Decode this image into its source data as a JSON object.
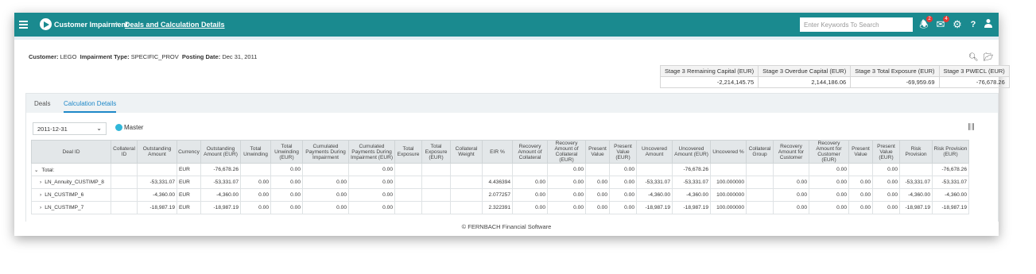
{
  "header": {
    "app_name": "Customer Impairment",
    "breadcrumb": "Deals and Calculation Details",
    "search_placeholder": "Enter Keywords To Search",
    "notifications_count": "2",
    "messages_count": "4",
    "brand_color": "#1a8a8f"
  },
  "info": {
    "customer_label": "Customer:",
    "customer_value": "LEGO",
    "impairment_label": "Impairment Type:",
    "impairment_value": "SPECIFIC_PROV",
    "posting_label": "Posting Date:",
    "posting_value": "Dec 31, 2011"
  },
  "stage_summary": {
    "headers": [
      "Stage 3 Remaining Capital (EUR)",
      "Stage 3 Overdue Capital (EUR)",
      "Stage 3 Total Exposure (EUR)",
      "Stage 3 PWECL (EUR)"
    ],
    "values": [
      "-2,214,145.75",
      "2,144,186.06",
      "-69,959.69",
      "-76,678.26"
    ]
  },
  "tabs": [
    {
      "label": "Deals",
      "active": false
    },
    {
      "label": "Calculation Details",
      "active": true
    }
  ],
  "filters": {
    "date_value": "2011-12-31",
    "legend_label": "Master"
  },
  "grid": {
    "columns": [
      "Deal ID",
      "Collateral ID",
      "Outstanding Amount",
      "Currency",
      "Outstanding Amount (EUR)",
      "Total Unwinding",
      "Total Unwinding (EUR)",
      "Cumulated Payments During Impairment",
      "Cumulated Payments During Impairment (EUR)",
      "Total Exposure",
      "Total Exposure (EUR)",
      "Collateral Weight",
      "EIR %",
      "Recovery Amount of Collateral",
      "Recovery Amount of Collateral (EUR)",
      "Present Value",
      "Present Value (EUR)",
      "Uncovered Amount",
      "Uncovered Amount (EUR)",
      "Uncovered %",
      "Collateral Group",
      "Recovery Amount for Customer",
      "Recovery Amount for Customer (EUR)",
      "Present Value",
      "Present Value (EUR)",
      "Risk Provision",
      "Risk Provision (EUR)"
    ],
    "rows": [
      {
        "expander": "⌄",
        "cells": [
          "Total:",
          "",
          "",
          "EUR",
          "-76,678.26",
          "",
          "0.00",
          "",
          "0.00",
          "",
          "",
          "",
          "",
          "",
          "0.00",
          "",
          "0.00",
          "",
          "-76,678.26",
          "",
          "",
          "",
          "0.00",
          "",
          "0.00",
          "",
          "-76,678.26"
        ]
      },
      {
        "expander": "›",
        "cells": [
          "LN_Annuity_CUSTIMP_8",
          "",
          "-53,331.07",
          "EUR",
          "-53,331.07",
          "0.00",
          "0.00",
          "0.00",
          "0.00",
          "",
          "",
          "",
          "4.436394",
          "0.00",
          "0.00",
          "0.00",
          "0.00",
          "-53,331.07",
          "-53,331.07",
          "100.000000",
          "",
          "0.00",
          "0.00",
          "0.00",
          "0.00",
          "-53,331.07",
          "-53,331.07"
        ]
      },
      {
        "expander": "›",
        "cells": [
          "LN_CUSTIMP_6",
          "",
          "-4,360.00",
          "EUR",
          "-4,360.00",
          "0.00",
          "0.00",
          "0.00",
          "0.00",
          "",
          "",
          "",
          "2.077257",
          "0.00",
          "0.00",
          "0.00",
          "0.00",
          "-4,360.00",
          "-4,360.00",
          "100.000000",
          "",
          "0.00",
          "0.00",
          "0.00",
          "0.00",
          "-4,360.00",
          "-4,360.00"
        ]
      },
      {
        "expander": "›",
        "cells": [
          "LN_CUSTIMP_7",
          "",
          "-18,987.19",
          "EUR",
          "-18,987.19",
          "0.00",
          "0.00",
          "0.00",
          "0.00",
          "",
          "",
          "",
          "2.322391",
          "0.00",
          "0.00",
          "0.00",
          "0.00",
          "-18,987.19",
          "-18,987.19",
          "100.000000",
          "",
          "0.00",
          "0.00",
          "0.00",
          "0.00",
          "-18,987.19",
          "-18,987.19"
        ]
      }
    ]
  },
  "footer": {
    "copyright": "© FERNBACH Financial Software"
  }
}
